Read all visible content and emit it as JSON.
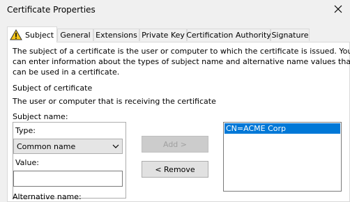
{
  "window": {
    "title": "Certificate Properties"
  },
  "tabs": [
    {
      "label": "Subject"
    },
    {
      "label": "General"
    },
    {
      "label": "Extensions"
    },
    {
      "label": "Private Key"
    },
    {
      "label": "Certification Authority"
    },
    {
      "label": "Signature"
    }
  ],
  "intro": {
    "line1": "The subject of a certificate is the user or computer to which the certificate is issued. You",
    "line2": "can enter information about the types of subject name and alternative name values that",
    "line3": "can be used in a certificate."
  },
  "subject_section": {
    "heading": "Subject of certificate",
    "description": "The user or computer that is receiving the certificate"
  },
  "subject_name": {
    "label": "Subject name:",
    "type_label": "Type:",
    "type_selected": "Common name",
    "value_label": "Value:",
    "value": ""
  },
  "buttons": {
    "add": "Add >",
    "remove": "< Remove"
  },
  "subject_list": {
    "items": [
      "CN=ACME Corp"
    ]
  },
  "alternative_name": {
    "label": "Alternative name:"
  },
  "colors": {
    "selection": "#0078d7",
    "warning": "#f5c518"
  }
}
